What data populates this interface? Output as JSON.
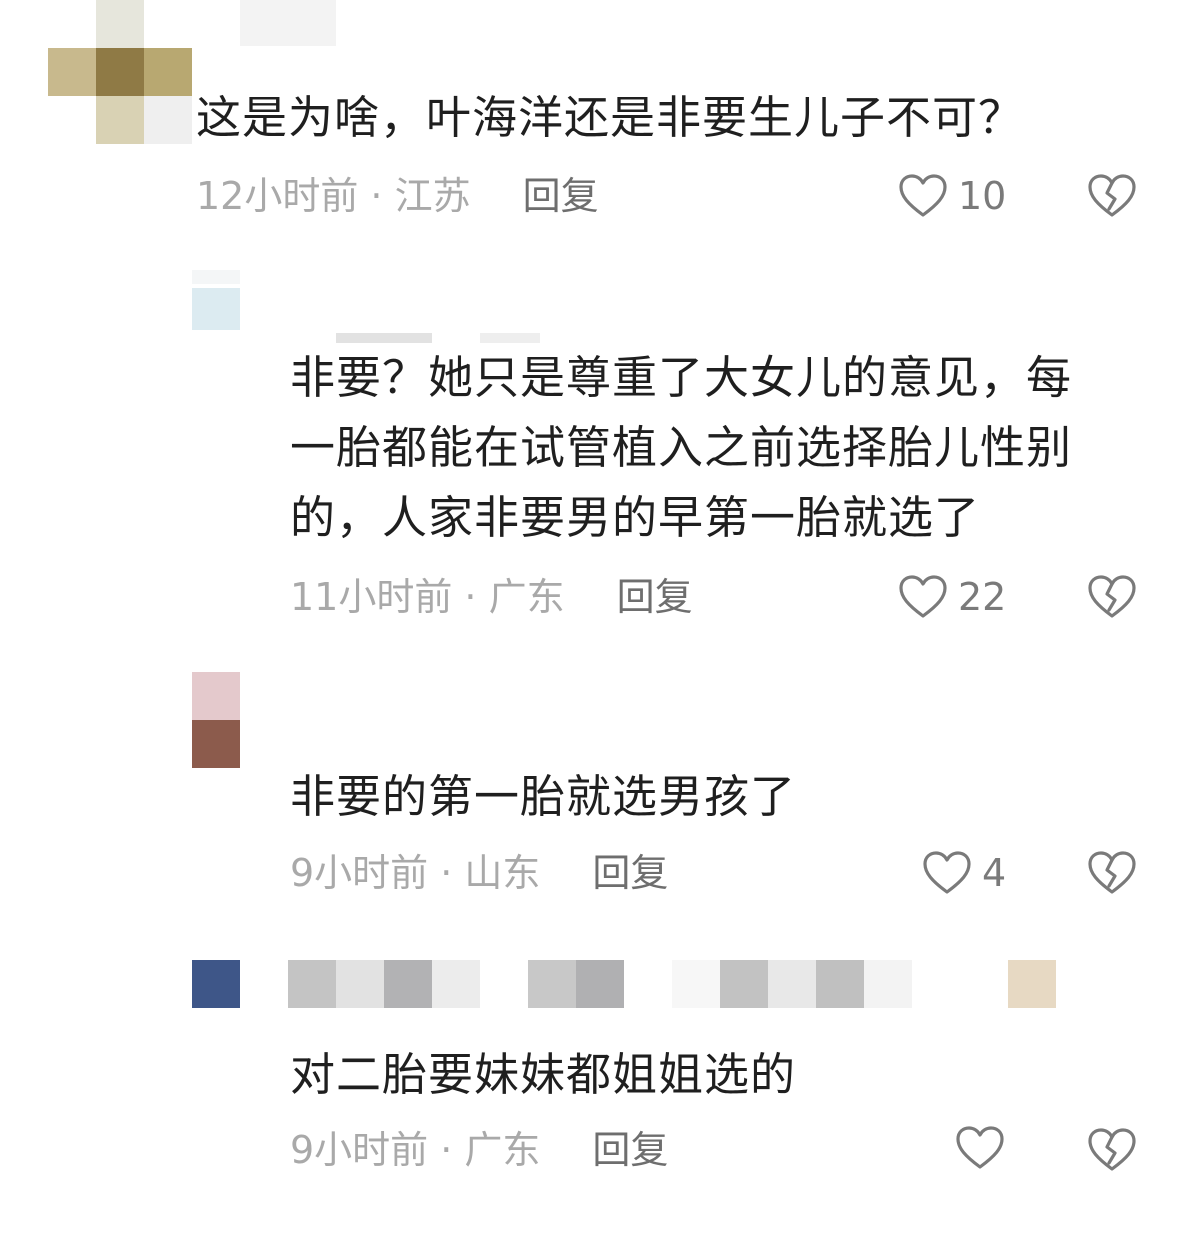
{
  "comments": [
    {
      "text_lines": [
        "这是为啥，叶海洋还是非要生儿子不可？"
      ],
      "time_location": "12小时前 · 江苏",
      "reply_label": "回复",
      "like_count": "10"
    },
    {
      "text_lines": [
        "非要？她只是尊重了大女儿的意见，每",
        "一胎都能在试管植入之前选择胎儿性别",
        "的，人家非要男的早第一胎就选了"
      ],
      "time_location": "11小时前 · 广东",
      "reply_label": "回复",
      "like_count": "22"
    },
    {
      "text_lines": [
        "非要的第一胎就选男孩了"
      ],
      "time_location": "9小时前 · 山东",
      "reply_label": "回复",
      "like_count": "4"
    },
    {
      "text_lines": [
        "对二胎要妹妹都姐姐选的"
      ],
      "time_location": "9小时前 · 广东",
      "reply_label": "回复",
      "like_count": ""
    }
  ],
  "icons": {
    "like": "heart-outline-icon",
    "dislike": "broken-heart-icon"
  },
  "colors": {
    "text": "#1f1f1f",
    "meta": "#a9a9a9",
    "reply": "#6e6e6e",
    "icon": "#7a7a7a"
  }
}
